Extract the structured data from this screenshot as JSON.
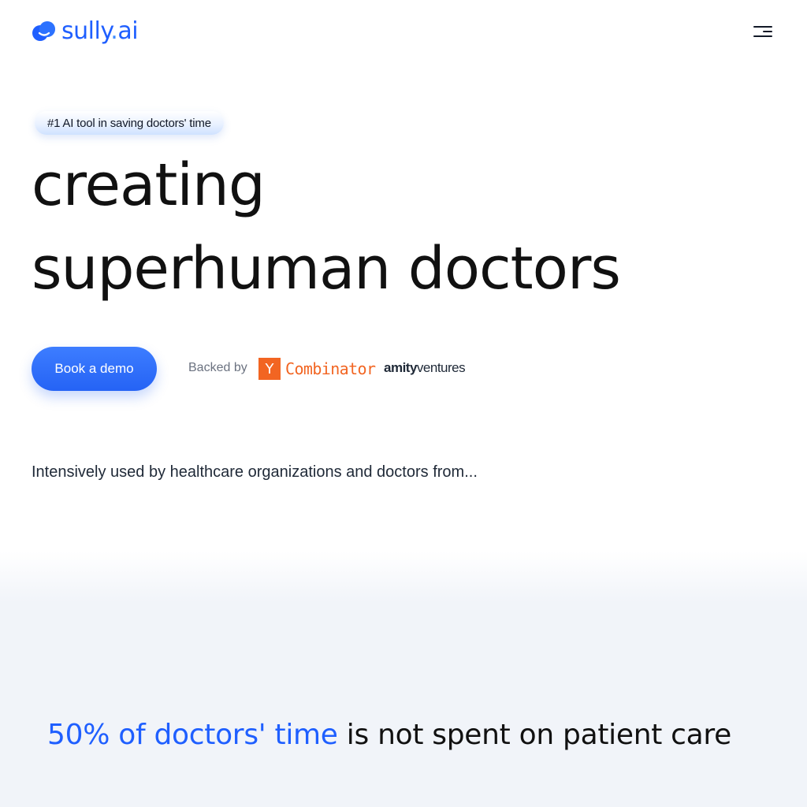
{
  "header": {
    "logo_name": "sully",
    "logo_dot": ".",
    "logo_tld": "ai",
    "logo_icon": "sully-logo-icon",
    "menu_icon": "hamburger-menu-icon"
  },
  "hero": {
    "badge": "#1 AI tool in saving doctors' time",
    "headline_line1": "creating",
    "headline_line2": "superhuman doctors",
    "cta_label": "Book a demo",
    "backed_by_label": "Backed by",
    "backers": {
      "yc_mark": "Y",
      "yc_name": "Combinator",
      "amity_bold": "amity",
      "amity_light": "ventures"
    },
    "used_by": "Intensively used by healthcare organizations and doctors from..."
  },
  "stats": {
    "highlight": "50% of doctors' time",
    "rest": " is not spent on patient care"
  },
  "colors": {
    "brand": "#1f5fff",
    "cta_bg": "#2563f5",
    "yc_orange": "#f26522",
    "band_bg": "#f1f4f9"
  }
}
